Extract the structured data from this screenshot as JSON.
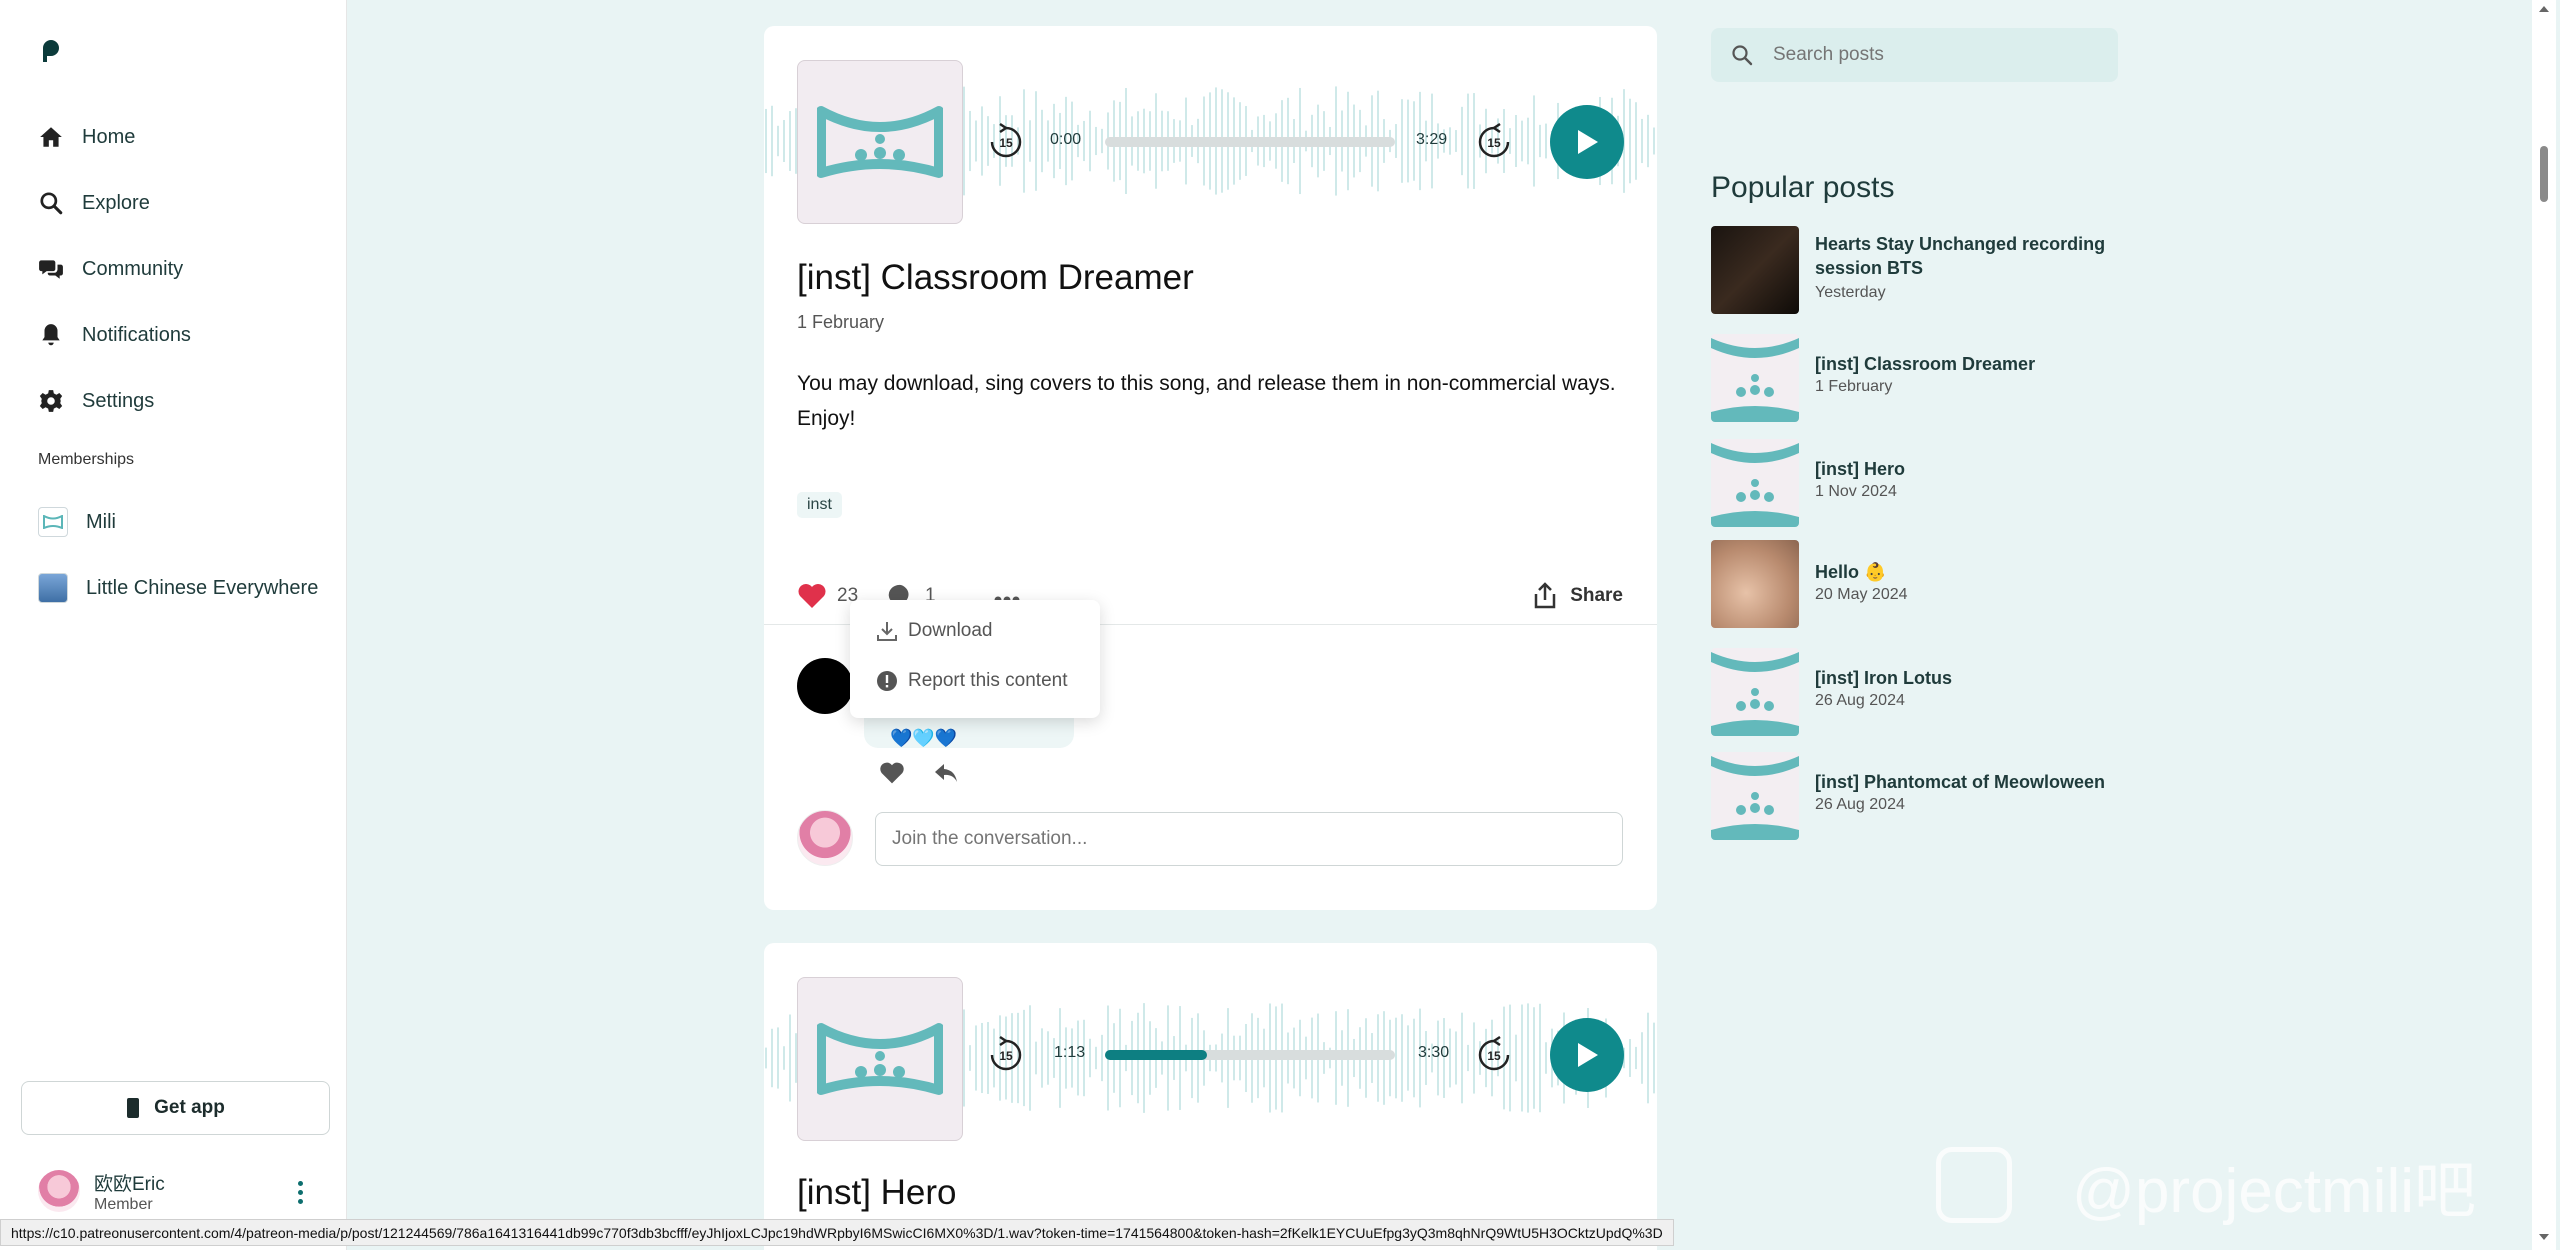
{
  "sidebar": {
    "nav": [
      "Home",
      "Explore",
      "Community",
      "Notifications",
      "Settings"
    ],
    "memberships_title": "Memberships",
    "memberships": [
      "Mili",
      "Little Chinese Everywhere"
    ],
    "get_app": "Get app",
    "user_name": "欧欧Eric",
    "user_role": "Member"
  },
  "post1": {
    "time_current": "0:00",
    "time_total": "3:29",
    "progress": 0,
    "title": "[inst] Classroom Dreamer",
    "date": "1 February",
    "body": "You may download, sing covers to this song, and release them in non-commercial ways. Enjoy!",
    "tag": "inst",
    "likes": "23",
    "comments": "1",
    "share": "Share",
    "comment_emoji": "💙🩵💙",
    "join_placeholder": "Join the conversation..."
  },
  "dropdown": {
    "download": "Download",
    "report": "Report this content"
  },
  "post2": {
    "time_current": "1:13",
    "time_total": "3:30",
    "progress": 0.35,
    "title": "[inst] Hero"
  },
  "search": {
    "placeholder": "Search posts"
  },
  "popular": {
    "title": "Popular posts",
    "items": [
      {
        "title": "Hearts Stay Unchanged recording session BTS",
        "date": "Yesterday"
      },
      {
        "title": "[inst] Classroom Dreamer",
        "date": "1 February"
      },
      {
        "title": "[inst] Hero",
        "date": "1 Nov 2024"
      },
      {
        "title": "Hello 👶",
        "date": "20 May 2024"
      },
      {
        "title": "[inst] Iron Lotus",
        "date": "26 Aug 2024"
      },
      {
        "title": "[inst] Phantomcat of Meowloween",
        "date": "26 Aug 2024"
      }
    ]
  },
  "status_url": "https://c10.patreonusercontent.com/4/patreon-media/p/post/121244569/786a1641316441db99c770f3db3bcfff/eyJhIjoxLCJpc19hdWRpbyI6MSwicCI6MX0%3D/1.wav?token-time=1741564800&token-hash=2fKelk1EYCUuEfpg3yQ3m8qhNrQ9WtU5H3OCktzUpdQ%3D",
  "watermark": "@projectmili吧",
  "colors": {
    "accent": "#0f8a8c",
    "background": "#e9f4f4",
    "like": "#e0314b"
  }
}
